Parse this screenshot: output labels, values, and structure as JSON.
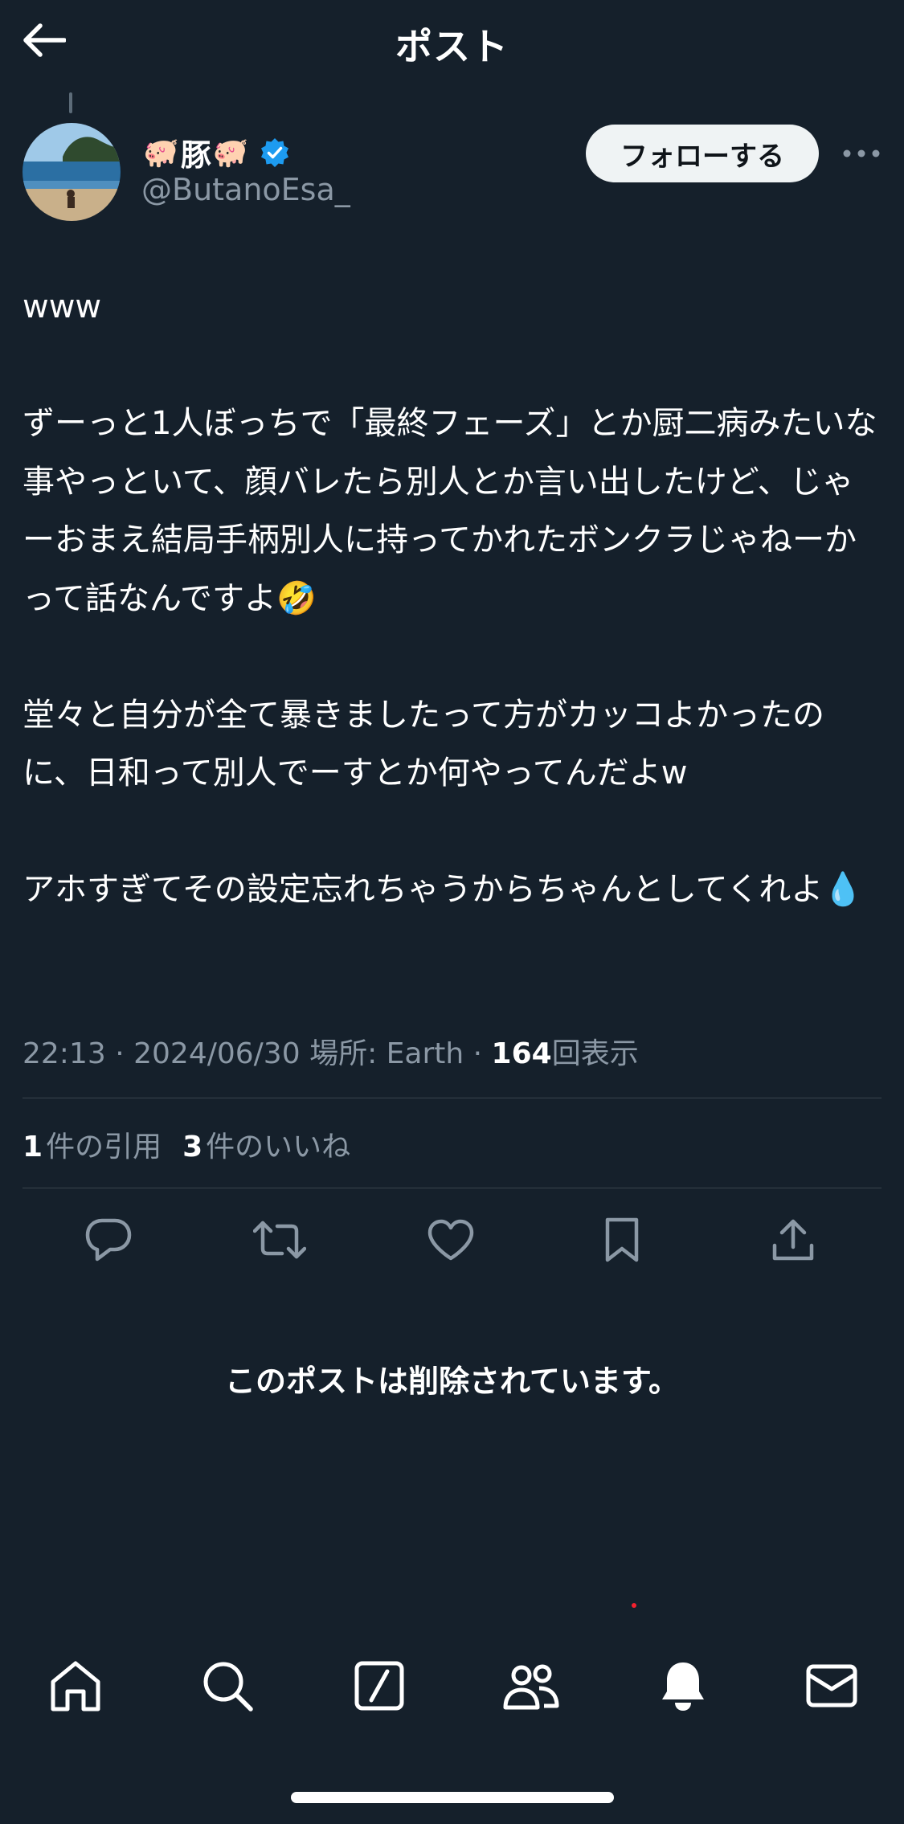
{
  "header": {
    "title": "ポスト"
  },
  "author": {
    "name_emoji": "🐖",
    "name_text": "豚",
    "handle": "@ButanoEsa_",
    "verified": true,
    "follow_label": "フォローする"
  },
  "post": {
    "paragraphs": [
      "www",
      "ずーっと1人ぼっちで「最終フェーズ」とか厨二病みたいな事やっといて、顔バレたら別人とか言い出したけど、じゃーおまえ結局手柄別人に持ってかれたボンクラじゃねーかって話なんですよ🤣",
      "堂々と自分が全て暴きましたって方がカッコよかったのに、日和って別人でーすとか何やってんだよw",
      "アホすぎてその設定忘れちゃうからちゃんとしてくれよ💧"
    ],
    "time": "22:13",
    "separator": "·",
    "date": "2024/06/30",
    "location_label": "場所: Earth",
    "views_count": "164",
    "views_label": "回表示"
  },
  "stats": {
    "quotes_count": "1",
    "quotes_label": "件の引用",
    "likes_count": "3",
    "likes_label": "件のいいね"
  },
  "actions": [
    "reply-icon",
    "repost-icon",
    "like-icon",
    "bookmark-icon",
    "share-icon"
  ],
  "deleted_notice": "このポストは削除されています。",
  "tabbar": [
    "home-icon",
    "search-icon",
    "grok-icon",
    "communities-icon",
    "notifications-icon",
    "messages-icon"
  ],
  "colors": {
    "background": "#15202b",
    "text": "#ffffff",
    "secondary": "#8b98a5",
    "divider": "#38444d",
    "verified": "#1d9bf0",
    "follow_bg": "#eff3f4",
    "notification_dot": "#f4212e"
  }
}
